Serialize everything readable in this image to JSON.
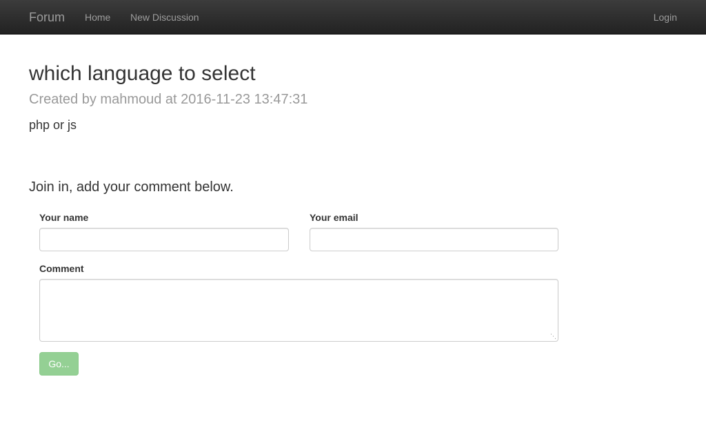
{
  "navbar": {
    "brand": "Forum",
    "links": [
      {
        "label": "Home"
      },
      {
        "label": "New Discussion"
      }
    ],
    "login_label": "Login"
  },
  "discussion": {
    "title": "which language to select",
    "meta_prefix": "Created by",
    "author": "mahmoud",
    "meta_at": "at",
    "created_at": "2016-11-23 13:47:31",
    "body": "php or js"
  },
  "comment_form": {
    "prompt": "Join in, add your comment below.",
    "name_label": "Your name",
    "name_value": "",
    "email_label": "Your email",
    "email_value": "",
    "comment_label": "Comment",
    "comment_value": "",
    "submit_label": "Go...",
    "submit_disabled": true,
    "submit_color": "#5cb85c"
  }
}
